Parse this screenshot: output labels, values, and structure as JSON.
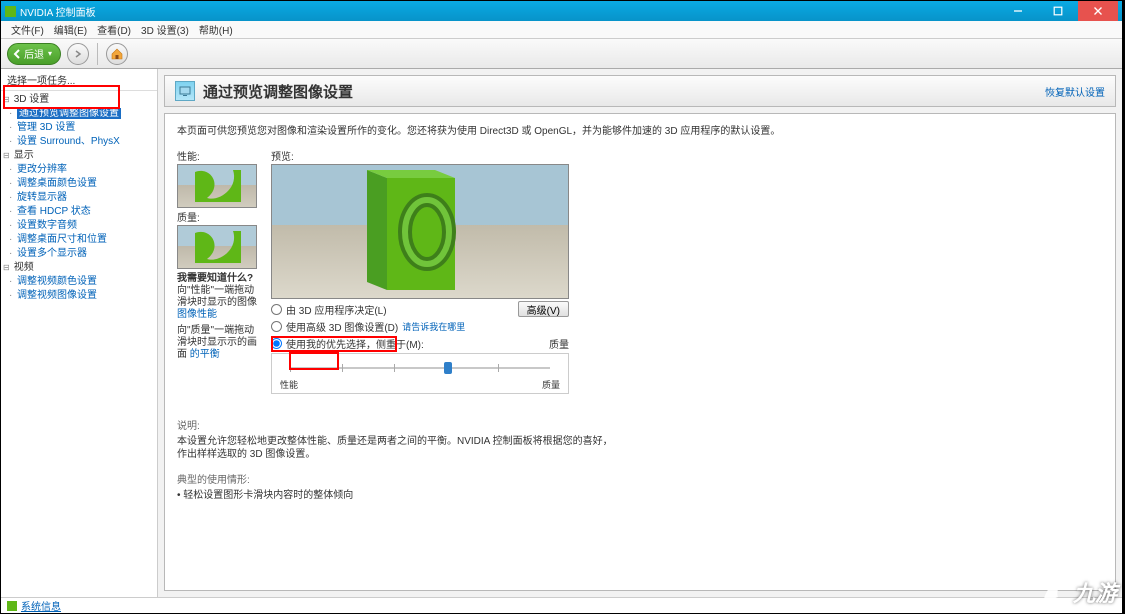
{
  "window": {
    "title": "NVIDIA 控制面板"
  },
  "menubar": [
    "文件(F)",
    "编辑(E)",
    "查看(D)",
    "3D 设置(3)",
    "帮助(H)"
  ],
  "toolbar": {
    "back": "后退"
  },
  "sidebar": {
    "header": "选择一项任务...",
    "groups": [
      {
        "label": "3D 设置",
        "items": [
          {
            "label": "通过预览调整图像设置",
            "selected": true
          },
          {
            "label": "管理 3D 设置"
          },
          {
            "label": "设置 Surround、PhysX"
          }
        ]
      },
      {
        "label": "显示",
        "items": [
          {
            "label": "更改分辨率"
          },
          {
            "label": "调整桌面颜色设置"
          },
          {
            "label": "旋转显示器"
          },
          {
            "label": "查看 HDCP 状态"
          },
          {
            "label": "设置数字音频"
          },
          {
            "label": "调整桌面尺寸和位置"
          },
          {
            "label": "设置多个显示器"
          }
        ]
      },
      {
        "label": "视频",
        "items": [
          {
            "label": "调整视频颜色设置"
          },
          {
            "label": "调整视频图像设置"
          }
        ]
      }
    ]
  },
  "header": {
    "title": "通过预览调整图像设置",
    "restore": "恢复默认设置"
  },
  "page": {
    "intro": "本页面可供您预览您对图像和渲染设置所作的变化。您还将获为使用 Direct3D 或 OpenGL，并为能够件加速的 3D 应用程序的默认设置。",
    "perf_label": "性能:",
    "qual_label": "质量:",
    "preview_label": "预览:",
    "help_q": "我需要知道什么?",
    "help_t1": "向\"性能\"一端拖动滑块时显示的图像",
    "help_link1": "图像性能",
    "help_t2": "向\"质量\"一端拖动滑块时显示示的画面",
    "help_link2": "的平衡",
    "opt1": "由 3D 应用程序决定(L)",
    "opt2": "使用高级 3D 图像设置(D)",
    "opt2_link": "请告诉我在哪里",
    "opt3": "使用我的优先选择，侧重于(M):",
    "opt3_right": "质量",
    "adv_btn": "高级(V)",
    "slider_left": "性能",
    "slider_right": "质量",
    "desc_hd": "说明:",
    "desc_t1": "本设置允许您轻松地更改整体性能、质量还是两者之间的平衡。NVIDIA 控制面板将根据您的喜好，",
    "desc_t2": "作出样样选取的 3D 图像设置。",
    "usage_hd": "典型的使用情形:",
    "usage_1": "轻松设置图形卡滑块内容时的整体倾向"
  },
  "statusbar": "系统信息",
  "watermark": "九游"
}
